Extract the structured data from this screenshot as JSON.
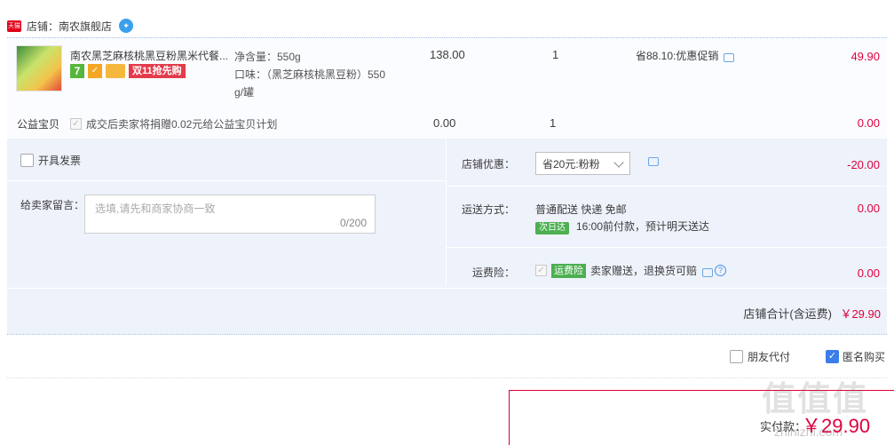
{
  "shop": {
    "label": "店铺：南农旗舰店",
    "platform_icon": "tmall-icon",
    "chat_icon": "wangwang-icon"
  },
  "item": {
    "title": "南农黑芝麻核桃黑豆粉黑米代餐...",
    "badges": [
      "7",
      "shield",
      "card",
      "双11抢先购"
    ],
    "spec_line1": "净含量：550g",
    "spec_line2": "口味：（黑芝麻核桃黑豆粉）550",
    "spec_line3": "g/罐",
    "unit_price": "138.00",
    "quantity": "1",
    "promo": "省88.10:优惠促销",
    "amount": "49.90"
  },
  "charity": {
    "label": "公益宝贝",
    "text": "成交后卖家将捐赠0.02元给公益宝贝计划",
    "price": "0.00",
    "quantity": "1",
    "amount": "0.00"
  },
  "invoice": {
    "label": "开具发票"
  },
  "memo": {
    "label": "给卖家留言：",
    "placeholder": "选填,请先和商家协商一致",
    "counter": "0/200"
  },
  "discount": {
    "label": "店铺优惠：",
    "selected": "省20元:粉粉",
    "amount": "-20.00"
  },
  "shipping": {
    "label": "运送方式：",
    "method": "普通配送 快递 免邮",
    "badge": "次日达",
    "eta": "16:00前付款，预计明天送达",
    "amount": "0.00"
  },
  "insurance": {
    "label": "运费险：",
    "badge": "运费险",
    "text": "卖家赠送，退换货可赔",
    "amount": "0.00"
  },
  "total": {
    "label": "店铺合计(含运费)",
    "value": "￥29.90"
  },
  "options": {
    "friend_pay": "朋友代付",
    "anonymous": "匿名购买"
  },
  "payment": {
    "label": "实付款：",
    "value": "￥29.90"
  },
  "watermark": {
    "text": "值值值",
    "url": "zhihizhi.com"
  },
  "colors": {
    "accent": "#e0003d",
    "panel": "#eef2fb",
    "link": "#3b7de9"
  }
}
